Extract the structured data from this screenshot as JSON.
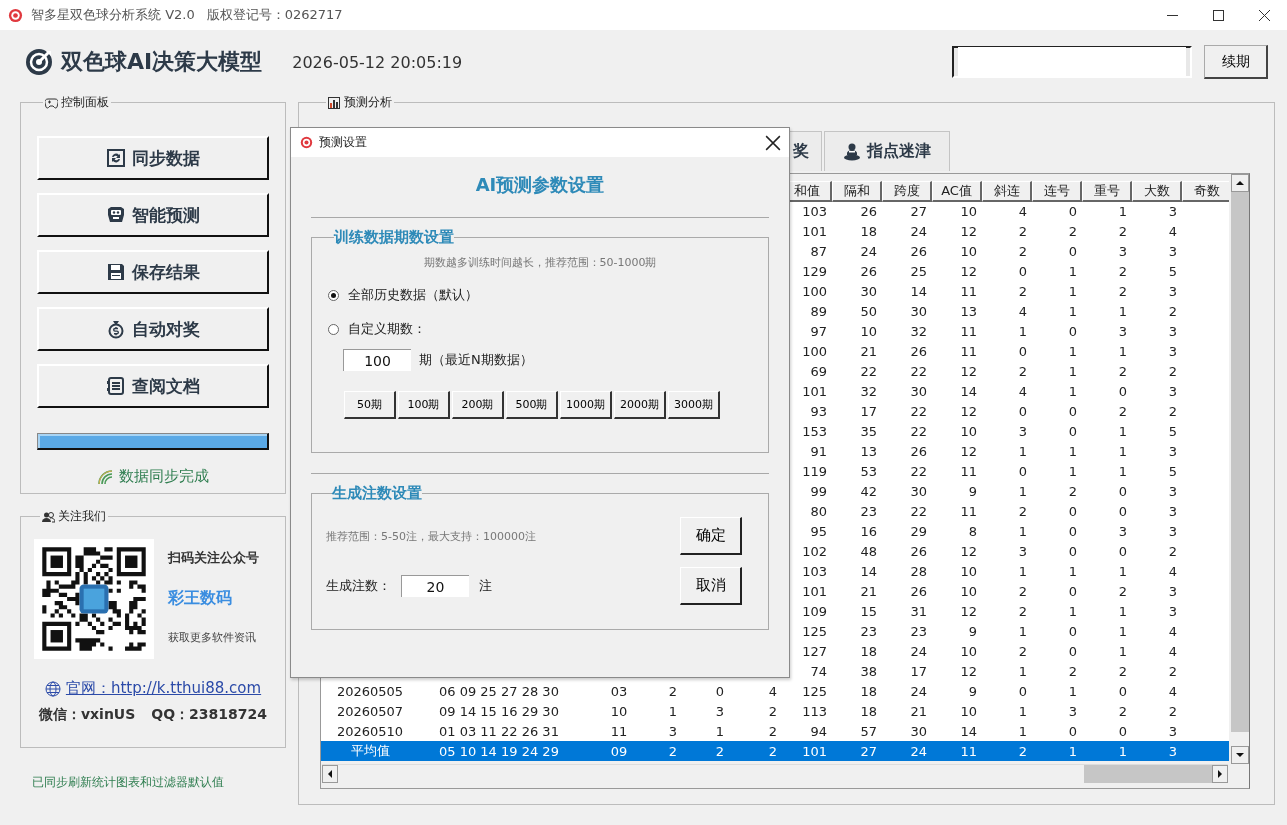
{
  "window": {
    "title": "智多星双色球分析系统 V2.0",
    "copyright": "版权登记号：0262717"
  },
  "header": {
    "app_name": "双色球AI决策大模型",
    "datetime": "2026-05-12 20:05:19",
    "renew_button": "续期"
  },
  "control_panel": {
    "title": "控制面板",
    "buttons": [
      {
        "label": "同步数据"
      },
      {
        "label": "智能预测"
      },
      {
        "label": "保存结果"
      },
      {
        "label": "自动对奖"
      },
      {
        "label": "查阅文档"
      }
    ],
    "progress": {
      "level": 1
    },
    "status": "数据同步完成"
  },
  "follow_us": {
    "title": "关注我们",
    "scan_text": "扫码关注公众号",
    "account": "彩王数码",
    "more_text": "获取更多软件资讯",
    "website": "官网：http://k.tthui88.com",
    "wechat": "微信：vxinUS",
    "qq": "QQ：23818724"
  },
  "analysis": {
    "title": "预测分析",
    "tabs": [
      {
        "label": "奖",
        "selected": false
      },
      {
        "label": "指点迷津",
        "selected": false
      }
    ],
    "table": {
      "columns": [
        "和值",
        "隔和",
        "跨度",
        "AC值",
        "斜连",
        "连号",
        "重号",
        "大数",
        "奇数"
      ],
      "rows": [
        {
          "selected": false,
          "stats": [
            "103",
            "26",
            "27",
            "10",
            "4",
            "0",
            "1",
            "3"
          ]
        },
        {
          "selected": false,
          "stats": [
            "101",
            "18",
            "24",
            "12",
            "2",
            "2",
            "2",
            "4"
          ]
        },
        {
          "selected": false,
          "stats": [
            "87",
            "24",
            "26",
            "10",
            "2",
            "0",
            "3",
            "3"
          ]
        },
        {
          "selected": false,
          "stats": [
            "129",
            "26",
            "25",
            "12",
            "0",
            "1",
            "2",
            "5"
          ]
        },
        {
          "selected": false,
          "stats": [
            "100",
            "30",
            "14",
            "11",
            "2",
            "1",
            "2",
            "3"
          ]
        },
        {
          "selected": false,
          "stats": [
            "89",
            "50",
            "30",
            "13",
            "4",
            "1",
            "1",
            "2"
          ]
        },
        {
          "selected": false,
          "stats": [
            "97",
            "10",
            "32",
            "11",
            "1",
            "0",
            "3",
            "3"
          ]
        },
        {
          "selected": false,
          "stats": [
            "100",
            "21",
            "26",
            "11",
            "0",
            "1",
            "1",
            "3"
          ]
        },
        {
          "selected": false,
          "stats": [
            "69",
            "22",
            "22",
            "12",
            "2",
            "1",
            "2",
            "2"
          ]
        },
        {
          "selected": false,
          "stats": [
            "101",
            "32",
            "30",
            "14",
            "4",
            "1",
            "0",
            "3"
          ]
        },
        {
          "selected": false,
          "stats": [
            "93",
            "17",
            "22",
            "12",
            "0",
            "0",
            "2",
            "2"
          ]
        },
        {
          "selected": false,
          "stats": [
            "153",
            "35",
            "22",
            "10",
            "3",
            "0",
            "1",
            "5"
          ]
        },
        {
          "selected": false,
          "stats": [
            "91",
            "13",
            "26",
            "12",
            "1",
            "1",
            "1",
            "3"
          ]
        },
        {
          "selected": false,
          "stats": [
            "119",
            "53",
            "22",
            "11",
            "0",
            "1",
            "1",
            "5"
          ]
        },
        {
          "selected": false,
          "stats": [
            "99",
            "42",
            "30",
            "9",
            "1",
            "2",
            "0",
            "3"
          ]
        },
        {
          "selected": false,
          "stats": [
            "80",
            "23",
            "22",
            "11",
            "2",
            "0",
            "0",
            "3"
          ]
        },
        {
          "selected": false,
          "stats": [
            "95",
            "16",
            "29",
            "8",
            "1",
            "0",
            "3",
            "3"
          ]
        },
        {
          "selected": false,
          "stats": [
            "102",
            "48",
            "26",
            "12",
            "3",
            "0",
            "0",
            "2"
          ]
        },
        {
          "selected": false,
          "stats": [
            "103",
            "14",
            "28",
            "10",
            "1",
            "1",
            "1",
            "4"
          ]
        },
        {
          "selected": false,
          "stats": [
            "101",
            "21",
            "26",
            "10",
            "2",
            "0",
            "2",
            "3"
          ]
        },
        {
          "selected": false,
          "stats": [
            "109",
            "15",
            "31",
            "12",
            "2",
            "1",
            "1",
            "3"
          ]
        },
        {
          "selected": false,
          "stats": [
            "125",
            "23",
            "23",
            "9",
            "1",
            "0",
            "1",
            "4"
          ]
        },
        {
          "selected": false,
          "stats": [
            "127",
            "18",
            "24",
            "10",
            "2",
            "0",
            "1",
            "4"
          ]
        },
        {
          "selected": false,
          "stats": [
            "74",
            "38",
            "17",
            "12",
            "1",
            "2",
            "2",
            "2"
          ]
        },
        {
          "selected": false,
          "issue": "20260505",
          "red": "06 09 25 27 28 30",
          "blue": "03",
          "column_4": "2",
          "column_5": "0",
          "column_6": "4",
          "stats": [
            "125",
            "18",
            "24",
            "9",
            "0",
            "1",
            "0",
            "4"
          ]
        },
        {
          "selected": false,
          "issue": "20260507",
          "red": "09 14 15 16 29 30",
          "blue": "10",
          "column_4": "1",
          "column_5": "3",
          "column_6": "2",
          "stats": [
            "113",
            "18",
            "21",
            "10",
            "1",
            "3",
            "2",
            "2"
          ]
        },
        {
          "selected": false,
          "issue": "20260510",
          "red": "01 03 11 22 26 31",
          "blue": "11",
          "column_4": "3",
          "column_5": "1",
          "column_6": "2",
          "stats": [
            "94",
            "57",
            "30",
            "14",
            "1",
            "0",
            "0",
            "3"
          ]
        },
        {
          "selected": true,
          "issue": "平均值",
          "red": "05 10 14 19 24 29",
          "blue": "09",
          "column_4": "2",
          "column_5": "2",
          "column_6": "2",
          "stats": [
            "101",
            "27",
            "24",
            "11",
            "2",
            "1",
            "1",
            "3"
          ]
        }
      ]
    }
  },
  "status_bar": "已同步刷新统计图表和过滤器默认值",
  "dialog": {
    "title": "预测设置",
    "heading": "AI预测参数设置",
    "training": {
      "title": "训练数据期数设置",
      "hint": "期数越多训练时间越长，推荐范围：50-1000期",
      "options": [
        {
          "label": "全部历史数据（默认）",
          "selected": true
        },
        {
          "label": "自定义期数：",
          "selected": false
        }
      ],
      "custom_value": "100",
      "custom_unit": "期（最近N期数据）",
      "presets": [
        "50期",
        "100期",
        "200期",
        "500期",
        "1000期",
        "2000期",
        "3000期"
      ]
    },
    "count": {
      "title": "生成注数设置",
      "hint": "推荐范围：5-50注，最大支持：100000注",
      "label": "生成注数：",
      "value": "20",
      "unit": "注"
    },
    "buttons": [
      "确定",
      "取消"
    ]
  }
}
